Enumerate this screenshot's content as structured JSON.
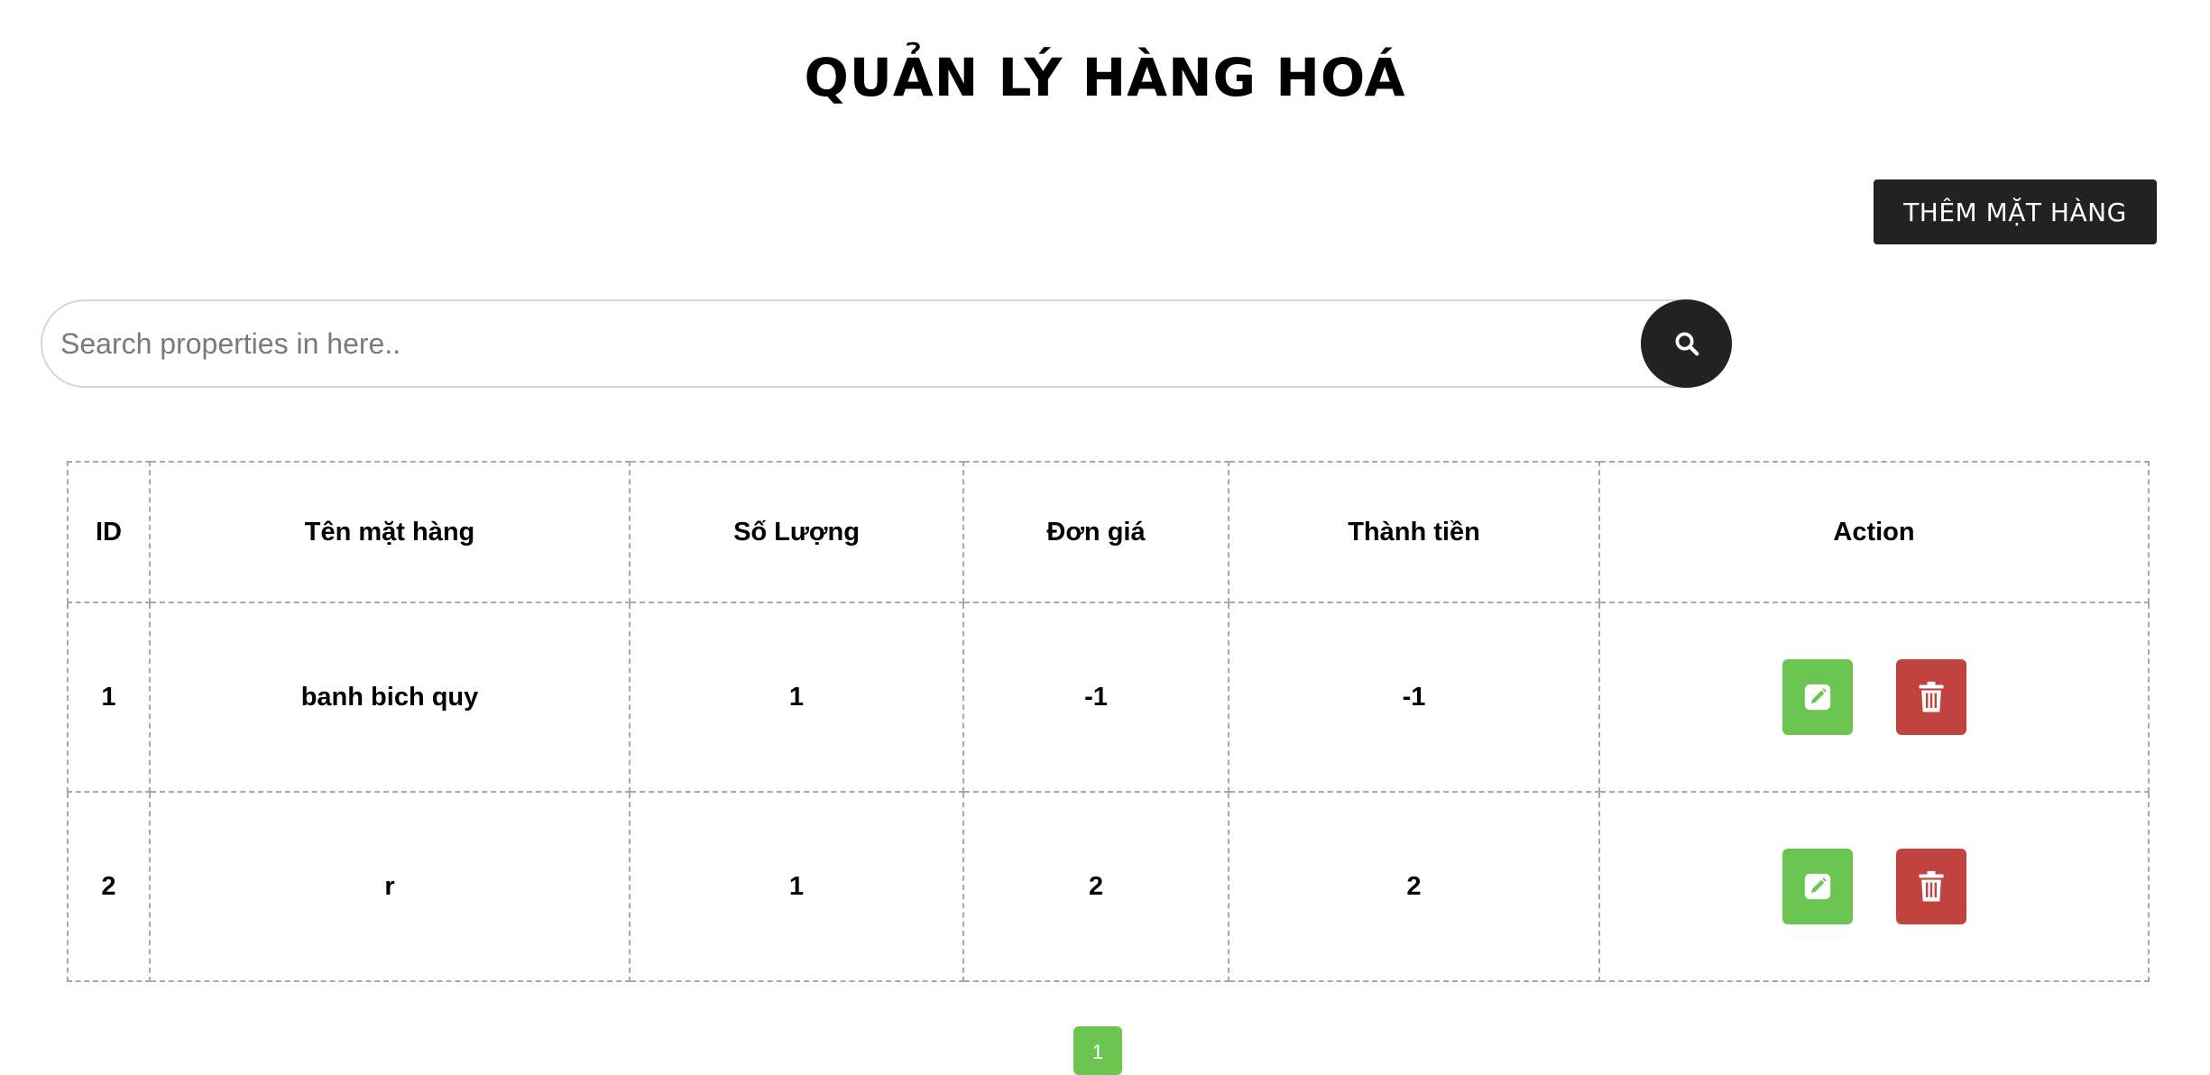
{
  "header": {
    "title": "QUẢN LÝ HÀNG HOÁ",
    "add_button_label": "THÊM MẶT HÀNG"
  },
  "search": {
    "placeholder": "Search properties in here..",
    "value": "",
    "button_icon": "search-icon"
  },
  "table": {
    "columns": [
      "ID",
      "Tên mặt hàng",
      "Số Lượng",
      "Đơn giá",
      "Thành tiền",
      "Action"
    ],
    "rows": [
      {
        "id": "1",
        "name": "banh bich quy",
        "quantity": "1",
        "unit_price": "-1",
        "total": "-1"
      },
      {
        "id": "2",
        "name": "r",
        "quantity": "1",
        "unit_price": "2",
        "total": "2"
      }
    ],
    "action_icons": {
      "edit": "pencil-icon",
      "delete": "trash-icon"
    }
  },
  "pagination": {
    "current_page": "1"
  },
  "colors": {
    "dark": "#222222",
    "edit_green": "#6cc551",
    "delete_red": "#c0433f",
    "border": "#a9a9a9"
  }
}
